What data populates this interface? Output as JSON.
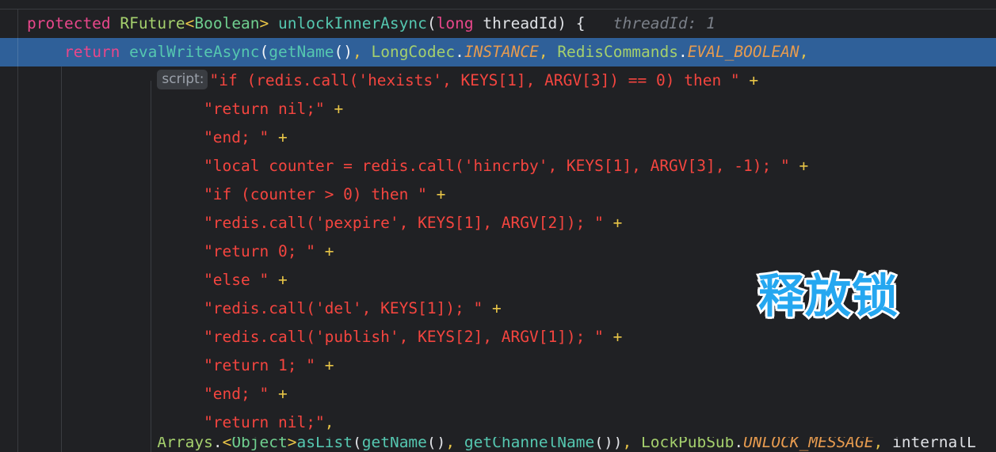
{
  "window": {
    "app": "code-editor",
    "theme_background": "#202124",
    "caret_line_background": "#2f6099"
  },
  "annotation": {
    "text": "释放锁",
    "color": "#25a7f0",
    "outline_color": "#ffffff"
  },
  "colors": {
    "keyword": "#e8478b",
    "string": "#f4453f",
    "operator": "#e8c547",
    "method": "#55c7b0",
    "class": "#a5d06d",
    "constant": "#e79b4f",
    "identifier": "#dfe1e5",
    "hint": "#7a7f88",
    "caret_line": "#2f6099",
    "gutter_border": "#393b40"
  },
  "hints": {
    "inline_value": "threadId: 1",
    "parameter_name": "script:"
  },
  "code": {
    "lines": [
      {
        "id": "signature",
        "tokens": [
          {
            "t": "protected",
            "c": "kw"
          },
          {
            "t": " ",
            "c": "punc"
          },
          {
            "t": "RFuture",
            "c": "type-y"
          },
          {
            "t": "<",
            "c": "angle"
          },
          {
            "t": "Boolean",
            "c": "type-g"
          },
          {
            "t": ">",
            "c": "angle"
          },
          {
            "t": " ",
            "c": "punc"
          },
          {
            "t": "unlockInnerAsync",
            "c": "method"
          },
          {
            "t": "(",
            "c": "punc"
          },
          {
            "t": "long",
            "c": "kw"
          },
          {
            "t": " ",
            "c": "punc"
          },
          {
            "t": "threadId",
            "c": "ident"
          },
          {
            "t": ") {",
            "c": "punc"
          },
          {
            "t": "   threadId: 1",
            "c": "hint-inline"
          }
        ]
      },
      {
        "id": "return-evalwriteasync",
        "highlighted": true,
        "tokens": [
          {
            "t": "    ",
            "c": "punc"
          },
          {
            "t": "return",
            "c": "kw"
          },
          {
            "t": " ",
            "c": "punc"
          },
          {
            "t": "evalWriteAsync",
            "c": "method"
          },
          {
            "t": "(",
            "c": "punc"
          },
          {
            "t": "getName",
            "c": "method"
          },
          {
            "t": "()",
            "c": "punc"
          },
          {
            "t": ",",
            "c": "comma"
          },
          {
            "t": " ",
            "c": "punc"
          },
          {
            "t": "LongCodec",
            "c": "cls"
          },
          {
            "t": ".",
            "c": "dot"
          },
          {
            "t": "INSTANCE",
            "c": "const"
          },
          {
            "t": ",",
            "c": "comma"
          },
          {
            "t": " ",
            "c": "punc"
          },
          {
            "t": "RedisCommands",
            "c": "cls"
          },
          {
            "t": ".",
            "c": "dot"
          },
          {
            "t": "EVAL_BOOLEAN",
            "c": "const"
          },
          {
            "t": ",",
            "c": "comma"
          }
        ]
      },
      {
        "id": "script-hexists",
        "param_hint": "script:",
        "indent": 14,
        "tokens": [
          {
            "t": "\"if (redis.call('hexists', KEYS[1], ARGV[3]) == 0) then \"",
            "c": "str"
          },
          {
            "t": " ",
            "c": "punc"
          },
          {
            "t": "+",
            "c": "comma"
          }
        ]
      },
      {
        "id": "script-return-nil-1",
        "indent": 19,
        "tokens": [
          {
            "t": "\"return nil;\"",
            "c": "str"
          },
          {
            "t": " ",
            "c": "punc"
          },
          {
            "t": "+",
            "c": "comma"
          }
        ]
      },
      {
        "id": "script-end-1",
        "indent": 19,
        "tokens": [
          {
            "t": "\"end; \"",
            "c": "str"
          },
          {
            "t": " ",
            "c": "punc"
          },
          {
            "t": "+",
            "c": "comma"
          }
        ]
      },
      {
        "id": "script-hincrby",
        "indent": 19,
        "tokens": [
          {
            "t": "\"local counter = redis.call('hincrby', KEYS[1], ARGV[3], -1); \"",
            "c": "str"
          },
          {
            "t": " ",
            "c": "punc"
          },
          {
            "t": "+",
            "c": "comma"
          }
        ]
      },
      {
        "id": "script-if-counter",
        "indent": 19,
        "tokens": [
          {
            "t": "\"if (counter > 0) then \"",
            "c": "str"
          },
          {
            "t": " ",
            "c": "punc"
          },
          {
            "t": "+",
            "c": "comma"
          }
        ]
      },
      {
        "id": "script-pexpire",
        "indent": 19,
        "tokens": [
          {
            "t": "\"redis.call('pexpire', KEYS[1], ARGV[2]); \"",
            "c": "str"
          },
          {
            "t": " ",
            "c": "punc"
          },
          {
            "t": "+",
            "c": "comma"
          }
        ]
      },
      {
        "id": "script-return-0",
        "indent": 19,
        "tokens": [
          {
            "t": "\"return 0; \"",
            "c": "str"
          },
          {
            "t": " ",
            "c": "punc"
          },
          {
            "t": "+",
            "c": "comma"
          }
        ]
      },
      {
        "id": "script-else",
        "indent": 19,
        "tokens": [
          {
            "t": "\"else \"",
            "c": "str"
          },
          {
            "t": " ",
            "c": "punc"
          },
          {
            "t": "+",
            "c": "comma"
          }
        ]
      },
      {
        "id": "script-del",
        "indent": 19,
        "tokens": [
          {
            "t": "\"redis.call('del', KEYS[1]); \"",
            "c": "str"
          },
          {
            "t": " ",
            "c": "punc"
          },
          {
            "t": "+",
            "c": "comma"
          }
        ]
      },
      {
        "id": "script-publish",
        "indent": 19,
        "tokens": [
          {
            "t": "\"redis.call('publish', KEYS[2], ARGV[1]); \"",
            "c": "str"
          },
          {
            "t": " ",
            "c": "punc"
          },
          {
            "t": "+",
            "c": "comma"
          }
        ]
      },
      {
        "id": "script-return-1",
        "indent": 19,
        "tokens": [
          {
            "t": "\"return 1; \"",
            "c": "str"
          },
          {
            "t": " ",
            "c": "punc"
          },
          {
            "t": "+",
            "c": "comma"
          }
        ]
      },
      {
        "id": "script-end-2",
        "indent": 19,
        "tokens": [
          {
            "t": "\"end; \"",
            "c": "str"
          },
          {
            "t": " ",
            "c": "punc"
          },
          {
            "t": "+",
            "c": "comma"
          }
        ]
      },
      {
        "id": "script-return-nil-2",
        "indent": 19,
        "tokens": [
          {
            "t": "\"return nil;\"",
            "c": "str"
          },
          {
            "t": ",",
            "c": "comma"
          }
        ]
      }
    ],
    "clipped_line": {
      "id": "arrays-aslist",
      "indent": 14,
      "tokens": [
        {
          "t": "Arrays",
          "c": "cls"
        },
        {
          "t": ".",
          "c": "dot"
        },
        {
          "t": "<",
          "c": "angle"
        },
        {
          "t": "Object",
          "c": "type-g"
        },
        {
          "t": ">",
          "c": "angle"
        },
        {
          "t": "asList",
          "c": "method"
        },
        {
          "t": "(",
          "c": "punc"
        },
        {
          "t": "getName",
          "c": "method"
        },
        {
          "t": "()",
          "c": "punc"
        },
        {
          "t": ",",
          "c": "comma"
        },
        {
          "t": " ",
          "c": "punc"
        },
        {
          "t": "getChannelName",
          "c": "method"
        },
        {
          "t": "())",
          "c": "punc"
        },
        {
          "t": ",",
          "c": "comma"
        },
        {
          "t": " ",
          "c": "punc"
        },
        {
          "t": "LockPubSub",
          "c": "cls"
        },
        {
          "t": ".",
          "c": "dot"
        },
        {
          "t": "UNLOCK_MESSAGE",
          "c": "const"
        },
        {
          "t": ",",
          "c": "comma"
        },
        {
          "t": " internalL",
          "c": "ident"
        }
      ]
    }
  }
}
